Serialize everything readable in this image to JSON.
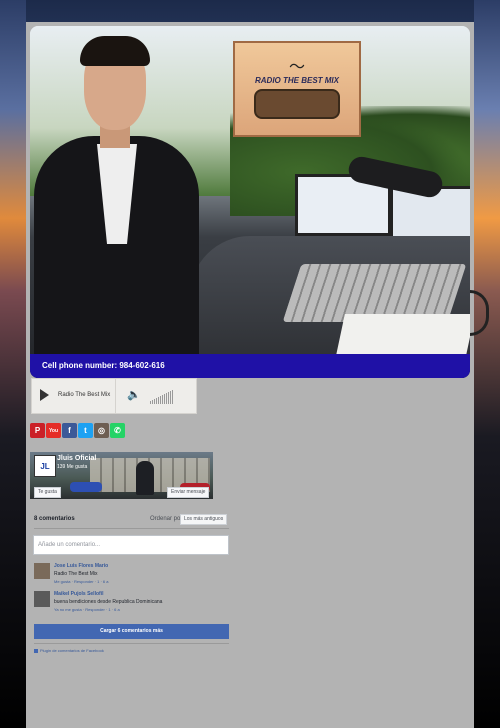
{
  "hero": {
    "caption": "Cell phone number: 984-602-616",
    "sign_title": "RADIO THE BEST MIX"
  },
  "player": {
    "station_name": "Radio The Best Mix",
    "volume_bars": [
      3,
      4,
      5,
      6,
      7,
      8,
      9,
      10,
      11,
      12,
      13,
      14
    ]
  },
  "social": [
    {
      "name": "pinterest",
      "glyph": "P",
      "color": "#cb2027"
    },
    {
      "name": "youtube",
      "glyph": "You",
      "color": "#e52d27"
    },
    {
      "name": "facebook",
      "glyph": "f",
      "color": "#3b5998"
    },
    {
      "name": "twitter",
      "glyph": "t",
      "color": "#1da1f2"
    },
    {
      "name": "instagram",
      "glyph": "◎",
      "color": "#6e5e52"
    },
    {
      "name": "whatsapp",
      "glyph": "✆",
      "color": "#25d366"
    }
  ],
  "fb_page": {
    "logo_text": "JL",
    "name": "Jluis Oficial",
    "likes": "139 Me gusta",
    "like_button": "Te gusta",
    "message_button": "Enviar mensaje"
  },
  "comments": {
    "count_label": "8 comentarios",
    "sort_label": "Ordenar por",
    "sort_value": "Los más antiguos",
    "placeholder": "Añade un comentario...",
    "items": [
      {
        "author": "Jose Luis Flores Mario",
        "text": "Radio The Best Mix",
        "actions": "Me gusta · Responder · 1 · 6 a"
      },
      {
        "author": "Maikel Pujols Sellofil",
        "text": "buena bendiciones desde Republica Dominicana",
        "actions": "Ya no me gusta · Responder · 1 · 6 a"
      }
    ],
    "load_more": "Cargar 6 comentarios más",
    "plugin": "Plugin de comentarios de Facebook"
  }
}
